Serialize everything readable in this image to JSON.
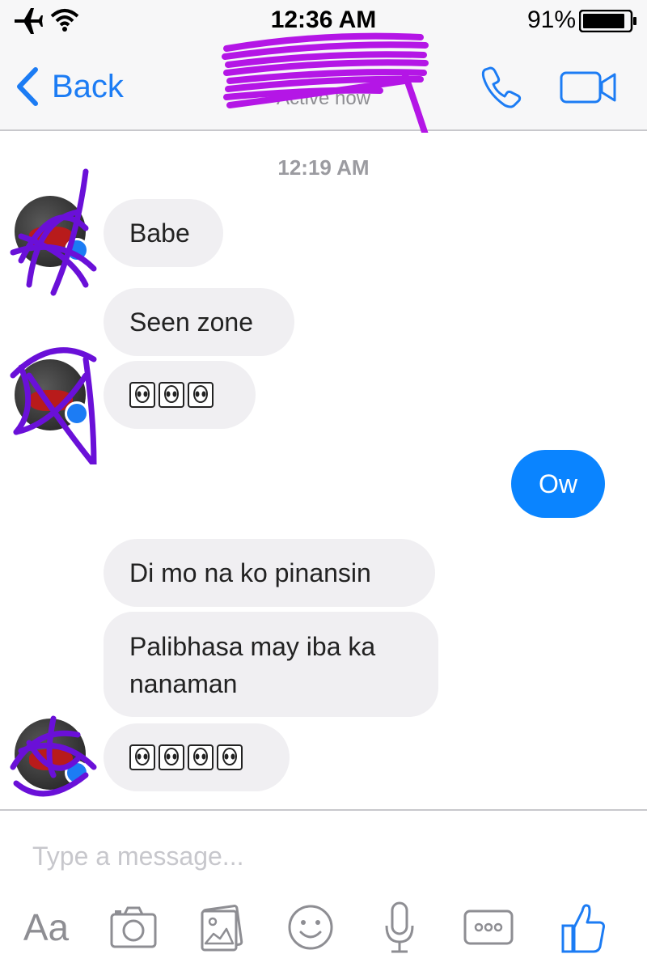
{
  "status_bar": {
    "time": "12:36 AM",
    "battery_percent": "91%",
    "battery_level": 0.91,
    "icons": [
      "airplane-icon",
      "wifi-icon",
      "battery-icon"
    ]
  },
  "nav": {
    "back_label": "Back",
    "title": "",
    "subtitle": "Active now",
    "actions": [
      "phone-icon",
      "video-camera-icon"
    ]
  },
  "chat": {
    "timestamp": "12:19 AM",
    "messages": [
      {
        "from": "them",
        "text": "Babe"
      },
      {
        "from": "them",
        "text": "Seen zone"
      },
      {
        "from": "them",
        "emoji": "alien-icon",
        "count": 3
      },
      {
        "from": "me",
        "text": "Ow"
      },
      {
        "from": "them",
        "text": "Di mo na ko pinansin"
      },
      {
        "from": "them",
        "text": "Palibhasa may iba ka nanaman"
      },
      {
        "from": "them",
        "emoji": "alien-icon",
        "count": 4
      }
    ]
  },
  "composer": {
    "placeholder": "Type a message...",
    "tools": [
      "Aa",
      "camera-icon",
      "gallery-icon",
      "smiley-icon",
      "microphone-icon",
      "more-icon",
      "like-icon"
    ]
  },
  "colors": {
    "accent": "#1c7cf4",
    "sent_bubble": "#0a84ff",
    "received_bubble": "#f0eff2",
    "scribble": "#a61ce0"
  }
}
